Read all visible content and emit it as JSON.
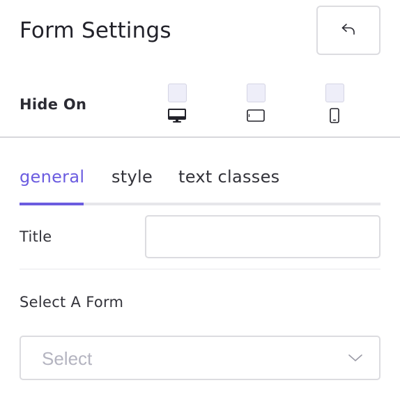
{
  "header": {
    "title": "Form Settings",
    "back_icon": "undo-icon"
  },
  "hide_on": {
    "label": "Hide On",
    "devices": [
      {
        "name": "desktop",
        "icon": "desktop-icon",
        "checked": false
      },
      {
        "name": "tablet",
        "icon": "tablet-icon",
        "checked": false
      },
      {
        "name": "mobile",
        "icon": "mobile-icon",
        "checked": false
      }
    ]
  },
  "tabs": [
    {
      "label": "general",
      "active": true
    },
    {
      "label": "style",
      "active": false
    },
    {
      "label": "text classes",
      "active": false
    }
  ],
  "fields": {
    "title": {
      "label": "Title",
      "value": "",
      "placeholder": ""
    },
    "select_form": {
      "label": "Select A Form",
      "placeholder": "Select"
    }
  },
  "colors": {
    "accent": "#6b5ce0",
    "checkbox_bg": "#eeeef9",
    "border": "#dcdce0",
    "placeholder": "#b4b4c0"
  }
}
